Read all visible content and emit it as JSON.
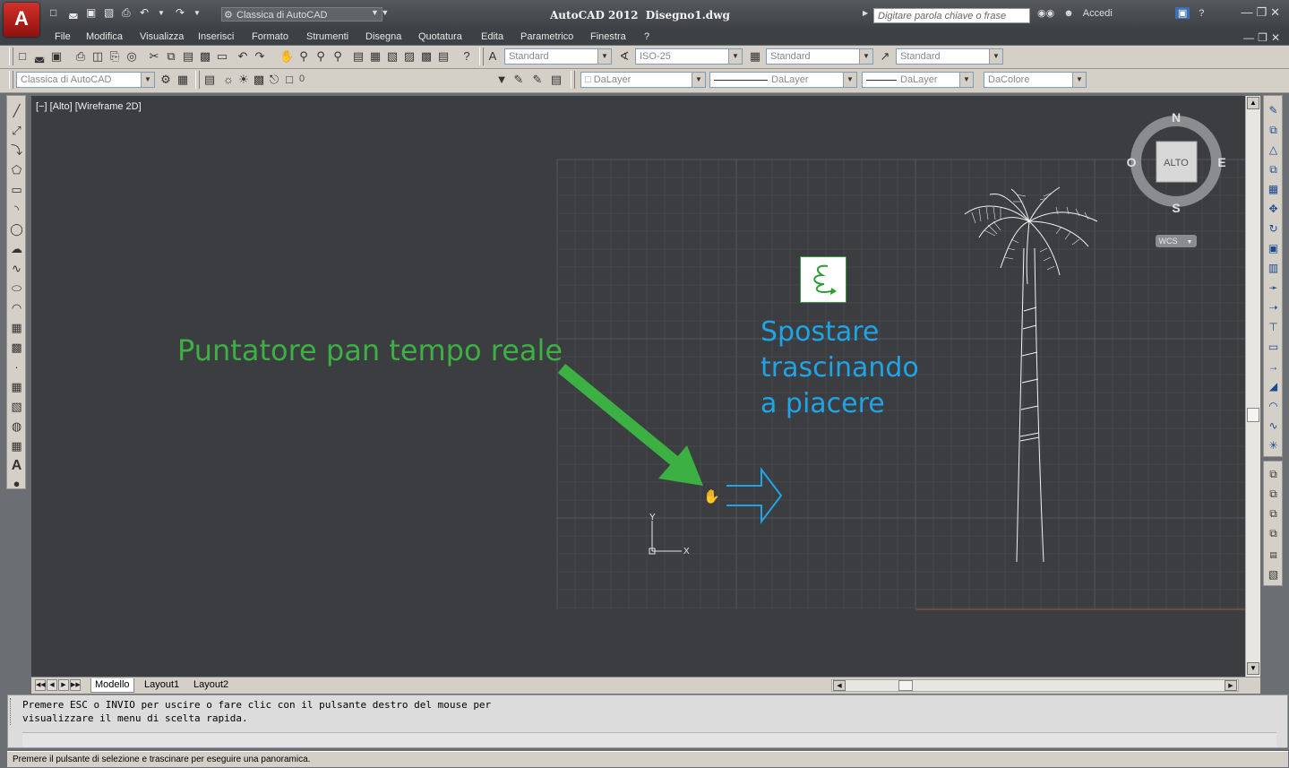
{
  "app": {
    "title": "AutoCAD 2012",
    "document": "Disegno1.dwg",
    "logo_letter": "A",
    "workspace": "Classica di AutoCAD",
    "search_placeholder": "Digitare parola chiave o frase",
    "signin": "Accedi",
    "help": "?"
  },
  "menus": [
    "File",
    "Modifica",
    "Visualizza",
    "Inserisci",
    "Formato",
    "Strumenti",
    "Disegna",
    "Quotatura",
    "Edita",
    "Parametrico",
    "Finestra",
    "?"
  ],
  "toolbar1": {
    "text_style": "Standard",
    "dim_style": "ISO-25",
    "table_style": "Standard",
    "mleader_style": "Standard"
  },
  "toolbar2": {
    "workspace": "Classica di AutoCAD",
    "layer": "0",
    "color": "DaLayer",
    "linetype": "DaLayer",
    "lineweight": "DaLayer",
    "plotstyle": "DaColore"
  },
  "viewport": {
    "label": "[−] [Alto] [Wireframe 2D]"
  },
  "viewcube": {
    "north": "N",
    "south": "S",
    "east": "E",
    "west": "O",
    "face": "ALTO",
    "ucs": "WCS"
  },
  "ucs_icon": {
    "x": "X",
    "y": "Y"
  },
  "annotations": {
    "left": "Puntatore pan tempo reale",
    "right_line1": "Spostare",
    "right_line2": "trascinando",
    "right_line3": "a piacere",
    "left_color": "#3cb043",
    "right_color": "#1fa4e6"
  },
  "tabs": [
    "Modello",
    "Layout1",
    "Layout2"
  ],
  "command": {
    "line1": "Premere ESC o INVIO per uscire o fare clic con il pulsante destro del mouse per",
    "line2": "visualizzare il menu di scelta rapida."
  },
  "status": "Premere il pulsante di selezione e trascinare per eseguire una panoramica."
}
